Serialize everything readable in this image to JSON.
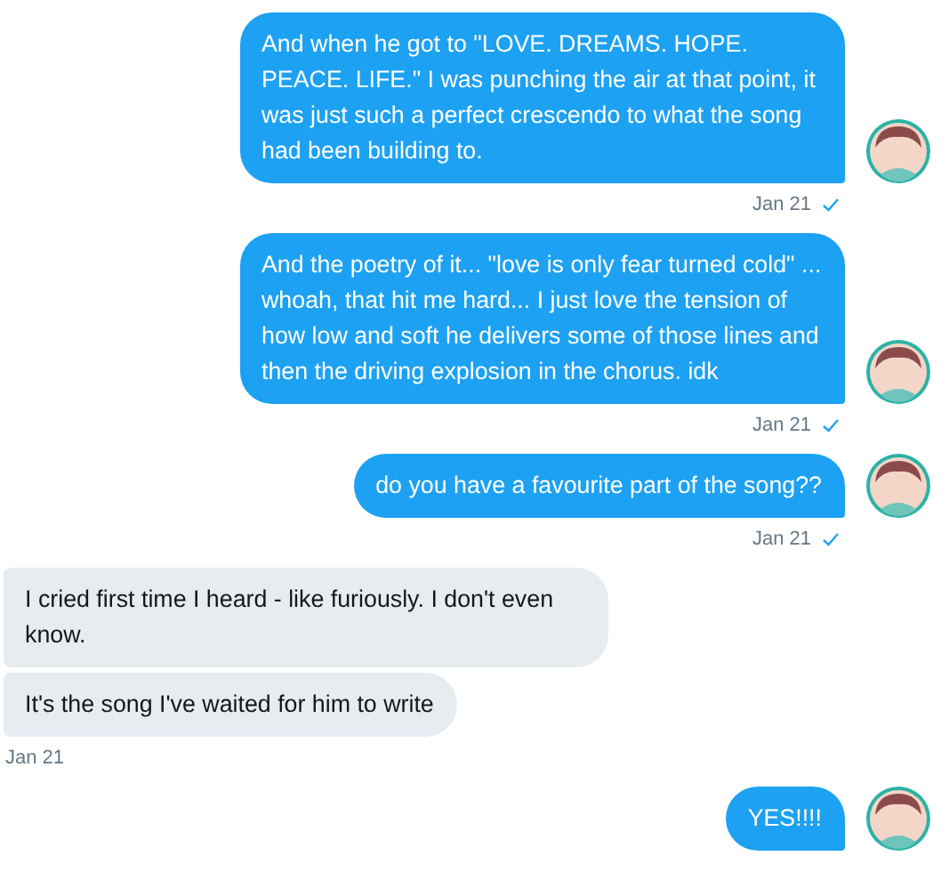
{
  "conversation": [
    {
      "kind": "sent",
      "bubbles": [
        "And when he got to \"LOVE. DREAMS. HOPE. PEACE. LIFE.\" I was punching the air at that point, it was just such a perfect crescendo to what the song had been building to."
      ],
      "time": "Jan 21",
      "read": true
    },
    {
      "kind": "sent",
      "bubbles": [
        "And the poetry of it... \"love is only fear turned cold\" ... whoah, that hit me hard... I just love the tension of how low and soft he delivers some of those lines and then the driving explosion in the chorus. idk"
      ],
      "time": "Jan 21",
      "read": true
    },
    {
      "kind": "sent",
      "bubbles": [
        "do you have a favourite part of the song??"
      ],
      "time": "Jan 21",
      "read": true
    },
    {
      "kind": "received",
      "bubbles": [
        "I cried first time I heard - like furiously. I don't even know.",
        "It's the song I've waited for him to write"
      ],
      "time": "Jan 21"
    },
    {
      "kind": "sent",
      "bubbles": [
        "YES!!!!"
      ]
    }
  ]
}
